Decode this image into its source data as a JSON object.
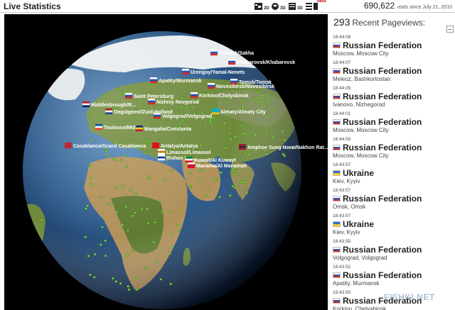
{
  "header": {
    "title": "Live Statistics",
    "visits_count": "690,622",
    "visits_suffix": "visits since July 21, 2010",
    "beta": "beta",
    "view_buttons": [
      "flat-map-view-icon",
      "globe-view-icon",
      "table-view-icon",
      "list-view-icon"
    ]
  },
  "colors": {
    "space": "#000000",
    "ocean_deep": "#10223f",
    "ocean": "#3b6fa4",
    "land_green": "#6f8a3c",
    "land_desert": "#b0915a",
    "snow": "#e8ecef",
    "dot": "#7ddc37",
    "label_text": "#ffffff"
  },
  "globe": {
    "labels": [
      {
        "text": "Yakutsk/Sakha",
        "flag": "ru"
      },
      {
        "text": "Khabarovsk/Khabarovsk",
        "flag": "ru"
      },
      {
        "text": "Urengoy/Yamal-Nenets",
        "flag": "ru"
      },
      {
        "text": "Apatity/Murmansk",
        "flag": "ru"
      },
      {
        "text": "Tomsk/Tomsk",
        "flag": "ru"
      },
      {
        "text": "Novosibirsk/Novosibirsk",
        "flag": "ru"
      },
      {
        "text": "Korkino/Chelyabinsk",
        "flag": "ru"
      },
      {
        "text": "Saint Petersburg",
        "flag": "ru"
      },
      {
        "text": "Nizhniy Novgorod",
        "flag": "ru"
      },
      {
        "text": "Middlesbrough/R...",
        "flag": "gb"
      },
      {
        "text": "Oegstgeest/Zuid-Holland",
        "flag": "nl"
      },
      {
        "text": "Volgograd/Volgograd",
        "flag": "ru"
      },
      {
        "text": "Almaty/Almaty City",
        "flag": "kz"
      },
      {
        "text": "Toulouse/Midi-...",
        "flag": "fr"
      },
      {
        "text": "Mangalia/Constanta",
        "flag": "ro"
      },
      {
        "text": "Casablanca/Grand Casablanca",
        "flag": "ma"
      },
      {
        "text": "Antalya/Antalya",
        "flag": "tr"
      },
      {
        "text": "Limassol/Limassol",
        "flag": "cy"
      },
      {
        "text": "Amphoe Sung Noen/Nakhon Rat...",
        "flag": "th"
      },
      {
        "text": "Rishon Le...",
        "flag": "il"
      },
      {
        "text": "Kuwait/Al Kuwayt",
        "flag": "kw"
      },
      {
        "text": "Manama/Al Manamah",
        "flag": "bh"
      }
    ]
  },
  "feed": {
    "count": "293",
    "heading": "Recent Pageviews:",
    "entries": [
      {
        "time": "18:44:08",
        "country": "Russian Federation",
        "flag": "ru",
        "city": "Moscow, Moscow City"
      },
      {
        "time": "18:44:07",
        "country": "Russian Federation",
        "flag": "ru",
        "city": "Meleuz, Bashkortostan"
      },
      {
        "time": "18:44:05",
        "country": "Russian Federation",
        "flag": "ru",
        "city": "Ivanovo, Nizhegorod"
      },
      {
        "time": "18:44:01",
        "country": "Russian Federation",
        "flag": "ru",
        "city": "Moscow, Moscow City"
      },
      {
        "time": "18:44:00",
        "country": "Russian Federation",
        "flag": "ru",
        "city": "Moscow, Moscow City"
      },
      {
        "time": "18:43:57",
        "country": "Ukraine",
        "flag": "ua",
        "city": "Kiev, Kyyiv"
      },
      {
        "time": "18:43:57",
        "country": "Russian Federation",
        "flag": "ru",
        "city": "Omsk, Omsk"
      },
      {
        "time": "18:43:57",
        "country": "Ukraine",
        "flag": "ua",
        "city": "Kiev, Kyyiv"
      },
      {
        "time": "18:43:55",
        "country": "Russian Federation",
        "flag": "ru",
        "city": "Volgograd, Volgograd"
      },
      {
        "time": "18:43:52",
        "country": "Russian Federation",
        "flag": "ru",
        "city": "Apatity, Murmansk"
      },
      {
        "time": "18:43:50",
        "country": "Russian Federation",
        "flag": "ru",
        "city": "Korkino, Chelyabinsk"
      }
    ]
  },
  "watermark": "FISHKI.NET"
}
